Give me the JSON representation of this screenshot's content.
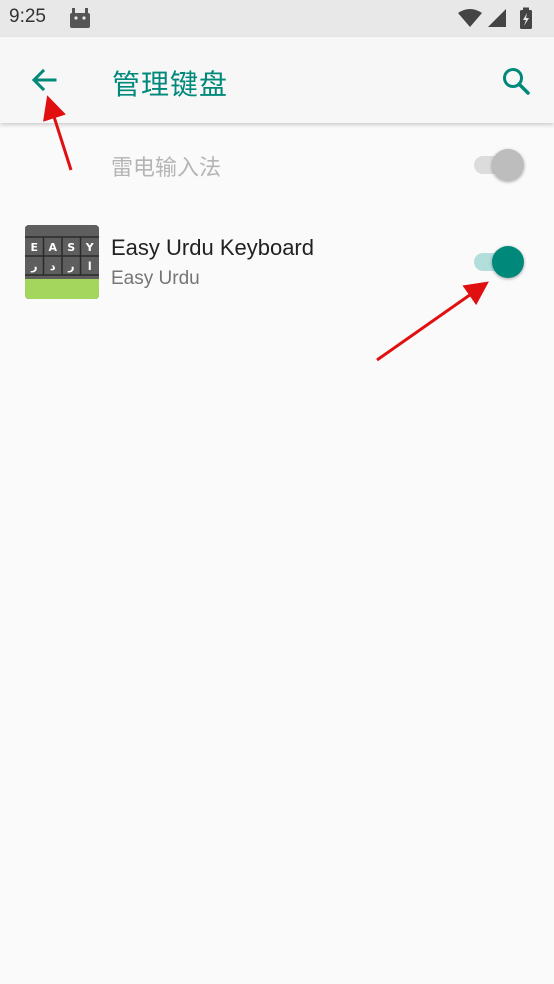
{
  "status_bar": {
    "time": "9:25"
  },
  "app_bar": {
    "title": "管理键盘"
  },
  "keyboards": [
    {
      "label": "雷电输入法",
      "enabled": false,
      "disabled_style": true
    },
    {
      "title": "Easy Urdu Keyboard",
      "subtitle": "Easy Urdu",
      "enabled": true
    }
  ],
  "app_icon": {
    "top_keys": [
      "E",
      "A",
      "S",
      "Y"
    ],
    "bottom_keys": [
      "ر",
      "د",
      "ر",
      "ا"
    ]
  },
  "colors": {
    "accent": "#00897b",
    "switch_on_track": "#b2dfdb",
    "switch_off_thumb": "#bdbdbd",
    "annotation_arrow": "#e01010"
  }
}
